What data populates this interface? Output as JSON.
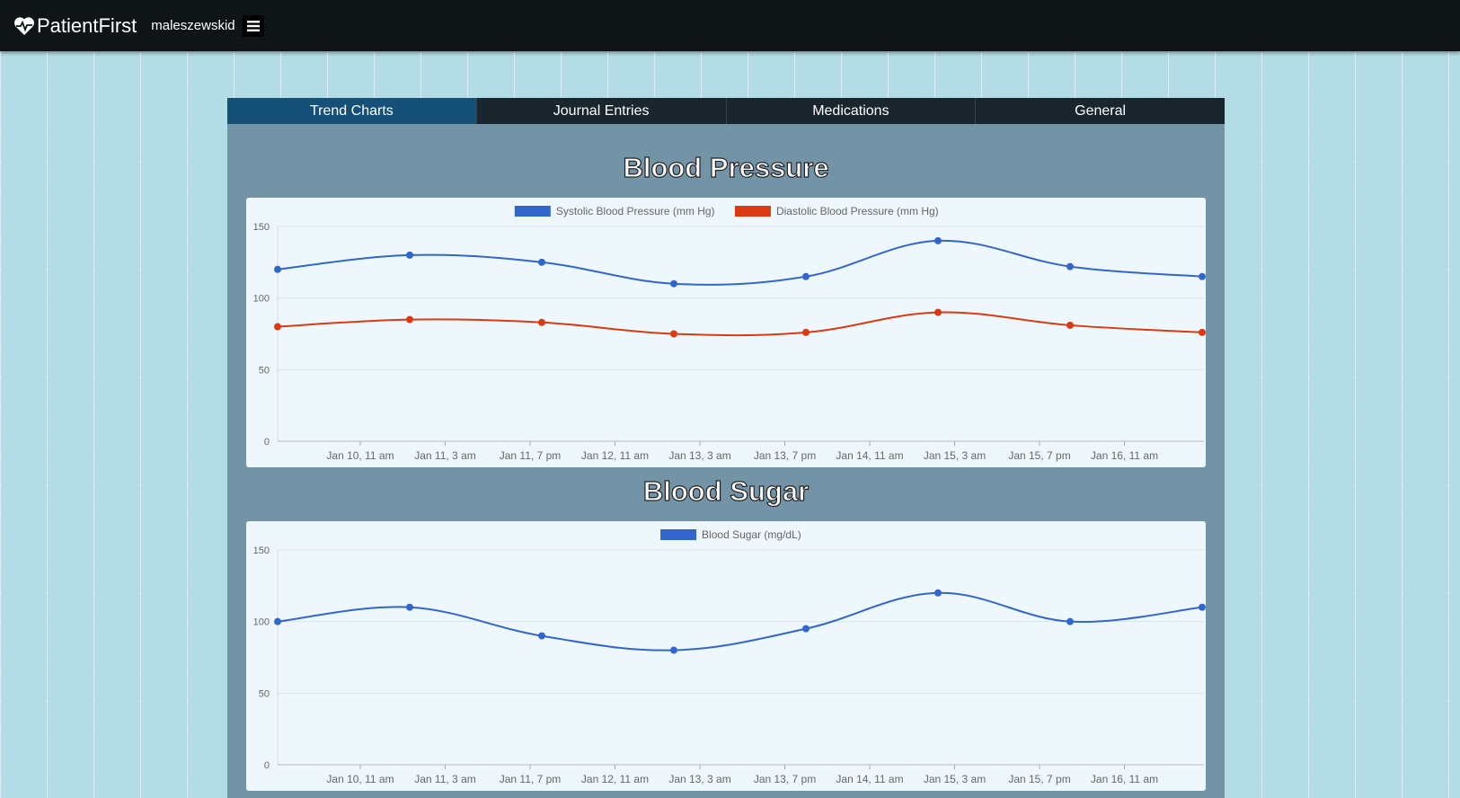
{
  "navbar": {
    "brand": "PatientFirst",
    "username": "maleszewskid",
    "menu_icon": "hamburger-menu-icon",
    "brand_icon": "heart-pulse-icon"
  },
  "tabs": [
    {
      "label": "Trend Charts",
      "active": true
    },
    {
      "label": "Journal Entries",
      "active": false
    },
    {
      "label": "Medications",
      "active": false
    },
    {
      "label": "General",
      "active": false
    }
  ],
  "sections": {
    "blood_pressure_title": "Blood Pressure",
    "blood_sugar_title": "Blood Sugar"
  },
  "colors": {
    "navbar": "#0f1417",
    "active_tab": "#145078",
    "tab": "#1b252d",
    "panel": "#7393a7",
    "series_blue": "#3366cc",
    "series_red": "#dc3912"
  },
  "chart_data": [
    {
      "type": "line",
      "x_tick_labels": [
        "Jan 10, 11 am",
        "Jan 11, 3 am",
        "Jan 11, 7 pm",
        "Jan 12, 11 am",
        "Jan 13, 3 am",
        "Jan 13, 7 pm",
        "Jan 14, 11 am",
        "Jan 15, 3 am",
        "Jan 15, 7 pm",
        "Jan 16, 11 am"
      ],
      "x_points": [
        "Jan 9, 11 pm",
        "Jan 10, 23 pm",
        "Jan 11, 11 pm",
        "Jan 12, 23 pm",
        "Jan 13, 11 pm",
        "Jan 14, 23 pm",
        "Jan 15, 11 pm",
        "Jan 16, 23 pm"
      ],
      "y_ticks": [
        0,
        50,
        100,
        150
      ],
      "ylim": [
        0,
        150
      ],
      "grid": true,
      "legend_position": "top",
      "series": [
        {
          "name": "Systolic Blood Pressure (mm Hg)",
          "color": "#3366cc",
          "values": [
            120,
            130,
            125,
            110,
            115,
            140,
            122,
            115
          ]
        },
        {
          "name": "Diastolic Blood Pressure (mm Hg)",
          "color": "#dc3912",
          "values": [
            80,
            85,
            83,
            75,
            76,
            90,
            81,
            76
          ]
        }
      ]
    },
    {
      "type": "line",
      "x_tick_labels": [
        "Jan 10, 11 am",
        "Jan 11, 3 am",
        "Jan 11, 7 pm",
        "Jan 12, 11 am",
        "Jan 13, 3 am",
        "Jan 13, 7 pm",
        "Jan 14, 11 am",
        "Jan 15, 3 am",
        "Jan 15, 7 pm",
        "Jan 16, 11 am"
      ],
      "y_ticks": [
        0,
        50,
        100,
        150
      ],
      "ylim": [
        0,
        150
      ],
      "grid": true,
      "legend_position": "top",
      "series": [
        {
          "name": "Blood Sugar (mg/dL)",
          "color": "#3366cc",
          "values": [
            100,
            110,
            90,
            80,
            95,
            120,
            100,
            110
          ]
        }
      ]
    }
  ]
}
